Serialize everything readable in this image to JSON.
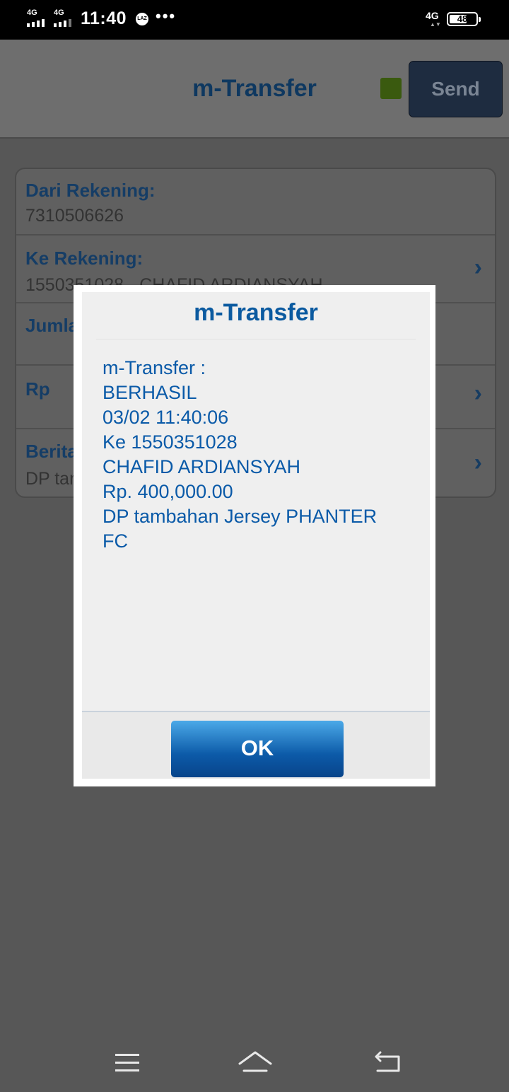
{
  "status_bar": {
    "sim1": "4G",
    "sim2": "4G",
    "time": "11:40",
    "app_badge": "LAZ",
    "more": "•••",
    "network": "4G",
    "battery": "48"
  },
  "header": {
    "title": "m-Transfer",
    "send_label": "Send",
    "indicator_color": "#3a5a0f"
  },
  "form": {
    "dari_label": "Dari Rekening:",
    "dari_value": "7310506626",
    "ke_label": "Ke Rekening:",
    "ke_value": "1550351028 - CHAFID ARDIANSYAH",
    "jumlah_label": "Jumlah",
    "rp_label": "Rp",
    "berita_label": "Berita",
    "berita_value": "DP tambahan Jersey PHANTER FC"
  },
  "dialog": {
    "title": "m-Transfer",
    "lines": [
      "m-Transfer :",
      "BERHASIL",
      "03/02 11:40:06",
      "Ke 1550351028",
      "CHAFID ARDIANSYAH",
      "Rp. 400,000.00",
      "DP tambahan Jersey PHANTER",
      "FC"
    ],
    "ok_label": "OK"
  },
  "colors": {
    "accent": "#0b5aa0",
    "overlay": "#575757"
  }
}
